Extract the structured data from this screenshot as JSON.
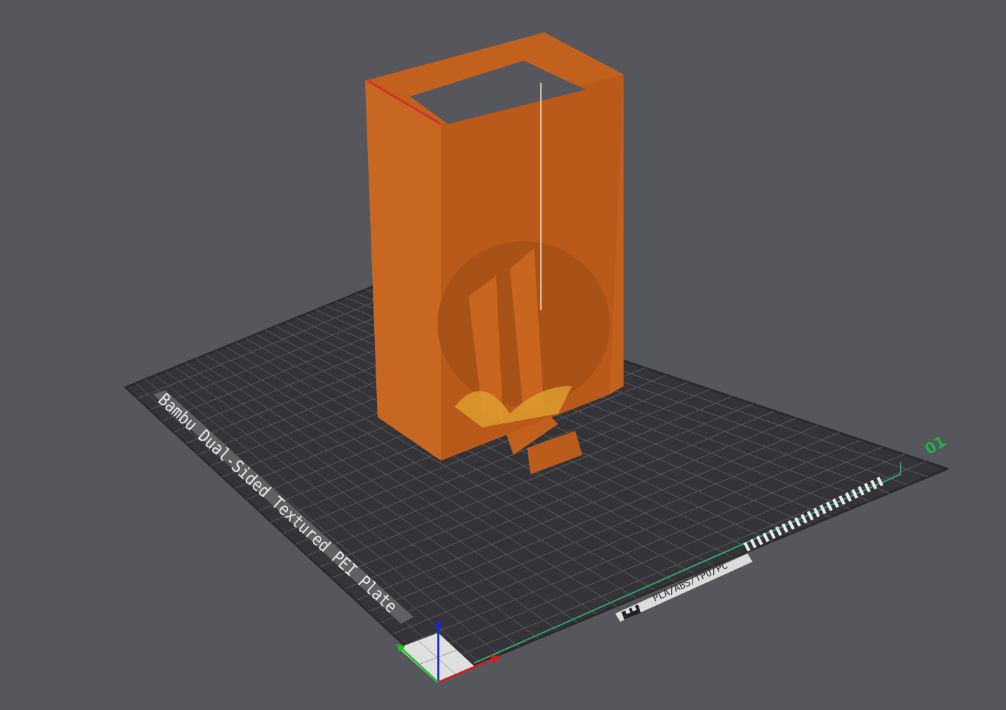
{
  "viewport": {
    "plate_name": "Bambu Dual-Sided Textured PEI Plate",
    "filament_label": "PLA/ABS/TPU/PC",
    "plate_number": "01"
  }
}
